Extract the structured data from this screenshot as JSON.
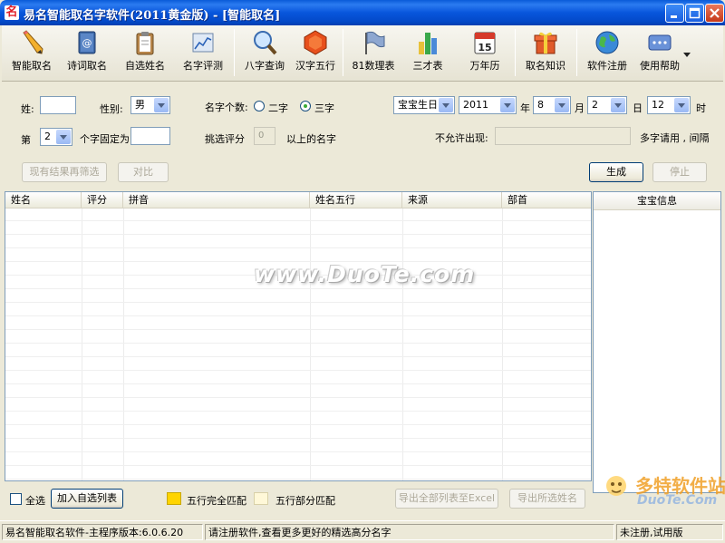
{
  "window": {
    "title": "易名智能取名字软件(2011黄金版) - [智能取名]",
    "logo_char": "名"
  },
  "toolbar": [
    {
      "label": "智能取名",
      "icon": "pencil-icon"
    },
    {
      "label": "诗词取名",
      "icon": "book-icon"
    },
    {
      "label": "自选姓名",
      "icon": "clipboard-icon"
    },
    {
      "label": "名字评测",
      "icon": "chart-icon"
    },
    {
      "label": "八字查询",
      "icon": "magnifier-icon"
    },
    {
      "label": "汉字五行",
      "icon": "hexagon-icon"
    },
    {
      "label": "81数理表",
      "icon": "flag-icon"
    },
    {
      "label": "三才表",
      "icon": "bar-chart-icon"
    },
    {
      "label": "万年历",
      "icon": "calendar-icon"
    },
    {
      "label": "取名知识",
      "icon": "gift-icon"
    },
    {
      "label": "软件注册",
      "icon": "globe-icon"
    },
    {
      "label": "使用帮助",
      "icon": "help-icon"
    }
  ],
  "calendar_day": "15",
  "form": {
    "surname_label": "姓:",
    "surname_value": "",
    "gender_label": "性别:",
    "gender_value": "男",
    "count_label": "名字个数:",
    "two_char": "二字",
    "three_char": "三字",
    "birth_type": "宝宝生日",
    "year": "2011",
    "year_label": "年",
    "month": "8",
    "month_label": "月",
    "day": "2",
    "day_label": "日",
    "hour": "12",
    "hour_label": "时",
    "order_label": "第",
    "order_value": "2",
    "fixed_label": "个字固定为",
    "fixed_value": "",
    "score_label": "挑选评分",
    "score_value": "0",
    "score_suffix": "以上的名字",
    "exclude_label": "不允许出现:",
    "exclude_value": "",
    "exclude_hint": "多字请用 , 间隔",
    "filter_button": "现有结果再筛选",
    "compare_button": "对比",
    "generate_button": "生成",
    "stop_button": "停止"
  },
  "grid": {
    "columns": [
      "姓名",
      "评分",
      "拼音",
      "姓名五行",
      "来源",
      "部首"
    ],
    "rows": [],
    "watermark": "www.DuoTe.com"
  },
  "info_panel": {
    "header": "宝宝信息"
  },
  "bottom": {
    "select_all": "全选",
    "add_button": "加入自选列表",
    "full_match": "五行完全匹配",
    "partial_match": "五行部分匹配",
    "export_excel": "导出全部列表至Excel",
    "export_selected": "导出所选姓名",
    "colors": {
      "full_match": "#ffd400",
      "partial_match": "#fff8d8"
    }
  },
  "brand_logo": {
    "line1": "多特软件站",
    "line2": "DuoTe.Com"
  },
  "status": {
    "version": "易名智能取名软件-主程序版本:6.0.6.20",
    "message": "请注册软件,查看更多更好的精选高分名字",
    "reg_state": "未注册,试用版"
  }
}
